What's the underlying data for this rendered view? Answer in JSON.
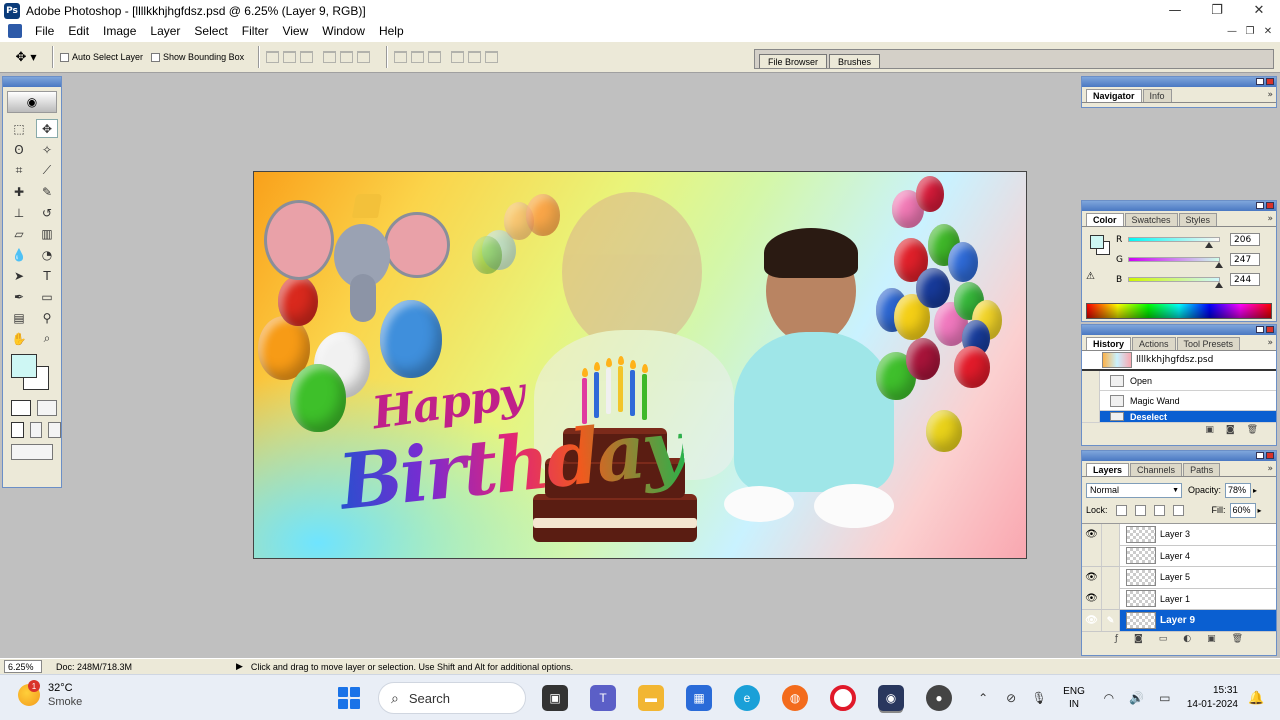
{
  "window": {
    "title": "Adobe Photoshop - [llllkkhjhgfdsz.psd @ 6.25% (Layer 9, RGB)]",
    "app_icon": "photoshop-icon",
    "controls": [
      "minimize-icon",
      "restore-icon",
      "close-icon"
    ]
  },
  "menubar": {
    "items": [
      "File",
      "Edit",
      "Image",
      "Layer",
      "Select",
      "Filter",
      "View",
      "Window",
      "Help"
    ]
  },
  "options_bar": {
    "auto_select_label": "Auto Select Layer",
    "show_bounding_label": "Show Bounding Box",
    "well_tabs": [
      "File Browser",
      "Brushes"
    ]
  },
  "toolbox": {
    "foreground_color": "#cef7f4",
    "background_color": "#ffffff",
    "tools": [
      {
        "name": "marquee-tool",
        "glyph": "⬚"
      },
      {
        "name": "move-tool",
        "glyph": "✥"
      },
      {
        "name": "lasso-tool",
        "glyph": "ʘ"
      },
      {
        "name": "magic-wand-tool",
        "glyph": "✧"
      },
      {
        "name": "crop-tool",
        "glyph": "⌗"
      },
      {
        "name": "slice-tool",
        "glyph": "⟋"
      },
      {
        "name": "healing-brush-tool",
        "glyph": "✚"
      },
      {
        "name": "brush-tool",
        "glyph": "✎"
      },
      {
        "name": "clone-stamp-tool",
        "glyph": "⊥"
      },
      {
        "name": "history-brush-tool",
        "glyph": "↺"
      },
      {
        "name": "eraser-tool",
        "glyph": "▱"
      },
      {
        "name": "gradient-tool",
        "glyph": "▥"
      },
      {
        "name": "blur-tool",
        "glyph": "💧"
      },
      {
        "name": "dodge-tool",
        "glyph": "◔"
      },
      {
        "name": "path-selection-tool",
        "glyph": "➤"
      },
      {
        "name": "type-tool",
        "glyph": "T"
      },
      {
        "name": "pen-tool",
        "glyph": "✒"
      },
      {
        "name": "shape-tool",
        "glyph": "▭"
      },
      {
        "name": "notes-tool",
        "glyph": "▤"
      },
      {
        "name": "eyedropper-tool",
        "glyph": "⚲"
      },
      {
        "name": "hand-tool",
        "glyph": "✋"
      },
      {
        "name": "zoom-tool",
        "glyph": "⌕"
      }
    ]
  },
  "canvas": {
    "greeting_line1": "Happy",
    "greeting_line2": "Birthday"
  },
  "navigator": {
    "tabs": [
      "Navigator",
      "Info"
    ]
  },
  "color_palette": {
    "tabs": [
      "Color",
      "Swatches",
      "Styles"
    ],
    "r": {
      "label": "R",
      "value": "206"
    },
    "g": {
      "label": "G",
      "value": "247"
    },
    "b": {
      "label": "B",
      "value": "244"
    },
    "swatch": "#cef7f4"
  },
  "history": {
    "tabs": [
      "History",
      "Actions",
      "Tool Presets"
    ],
    "snapshot": "llllkkhjhgfdsz.psd",
    "items": [
      "Open",
      "Magic Wand",
      "Deselect"
    ]
  },
  "layers": {
    "tabs": [
      "Layers",
      "Channels",
      "Paths"
    ],
    "blend_mode": "Normal",
    "opacity_label": "Opacity:",
    "opacity": "78%",
    "lock_label": "Lock:",
    "fill_label": "Fill:",
    "fill": "60%",
    "items": [
      {
        "name": "Layer 3",
        "visible": "👁"
      },
      {
        "name": "Layer 4",
        "visible": ""
      },
      {
        "name": "Layer 5",
        "visible": "👁"
      },
      {
        "name": "Layer 1",
        "visible": "👁"
      },
      {
        "name": "Layer 9",
        "visible": "👁"
      }
    ]
  },
  "statusbar": {
    "zoom": "6.25%",
    "doc": "Doc: 248M/718.3M",
    "hint": "Click and drag to move layer or selection.  Use Shift and Alt for additional options."
  },
  "taskbar": {
    "weather_temp": "32°C",
    "weather_cond": "Smoke",
    "weather_badge": "1",
    "search_placeholder": "Search",
    "lang_line1": "ENG",
    "lang_line2": "IN",
    "time": "15:31",
    "date": "14-01-2024"
  }
}
